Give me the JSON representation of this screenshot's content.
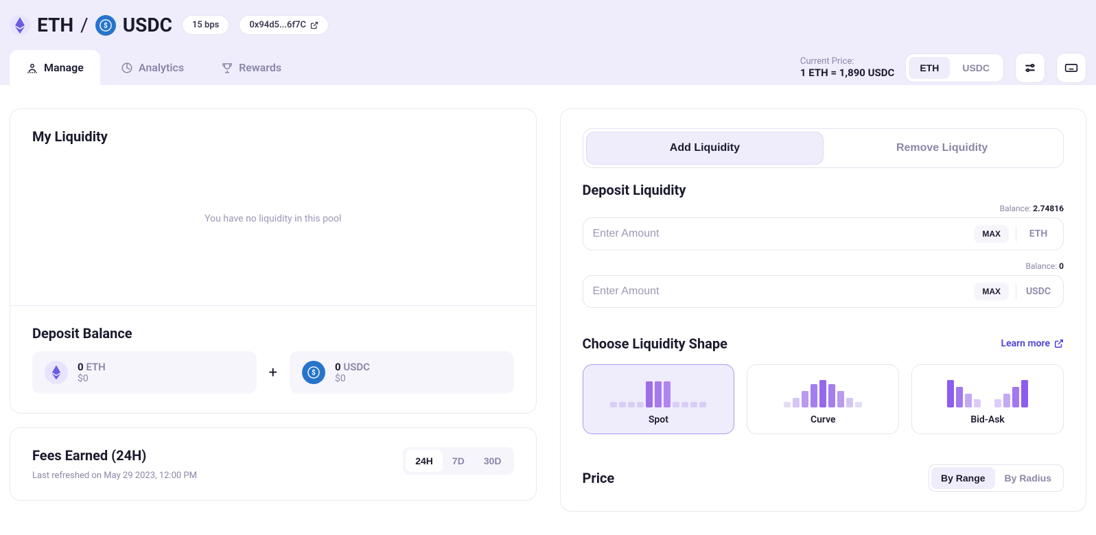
{
  "header": {
    "token0": "ETH",
    "token1": "USDC",
    "slash": "/",
    "fee_tier": "15 bps",
    "address": "0x94d5...6f7C"
  },
  "tabs": {
    "manage": "Manage",
    "analytics": "Analytics",
    "rewards": "Rewards"
  },
  "price": {
    "label": "Current Price:",
    "value": "1 ETH = 1,890 USDC",
    "toggle0": "ETH",
    "toggle1": "USDC"
  },
  "liquidity": {
    "title": "My Liquidity",
    "empty": "You have no liquidity in this pool"
  },
  "deposit_balance": {
    "title": "Deposit Balance",
    "t0_amount": "0",
    "t0_symbol": "ETH",
    "t0_usd": "$0",
    "plus": "+",
    "t1_amount": "0",
    "t1_symbol": "USDC",
    "t1_usd": "$0"
  },
  "fees": {
    "title": "Fees Earned (24H)",
    "sub": "Last refreshed on May 29 2023, 12:00 PM",
    "p24h": "24H",
    "p7d": "7D",
    "p30d": "30D"
  },
  "addremove": {
    "add": "Add Liquidity",
    "remove": "Remove Liquidity"
  },
  "deposit": {
    "title": "Deposit Liquidity",
    "balance_label": "Balance: ",
    "bal0": "2.74816",
    "bal1": "0",
    "placeholder": "Enter Amount",
    "max": "MAX",
    "sym0": "ETH",
    "sym1": "USDC"
  },
  "shape": {
    "title": "Choose Liquidity Shape",
    "learn": "Learn more",
    "spot": "Spot",
    "curve": "Curve",
    "bidask": "Bid-Ask"
  },
  "price_section": {
    "title": "Price",
    "by_range": "By Range",
    "by_radius": "By Radius"
  }
}
